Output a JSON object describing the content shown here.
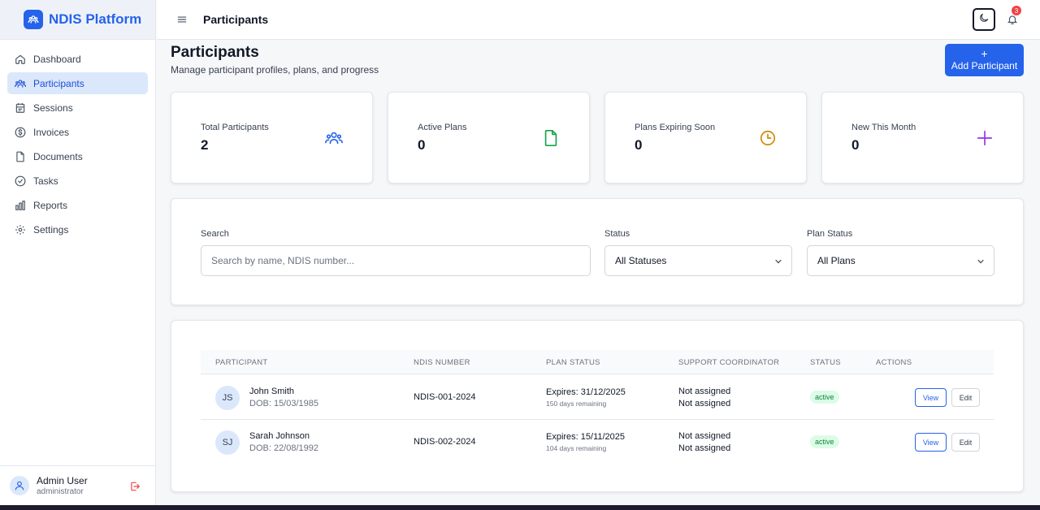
{
  "brand": {
    "name": "NDIS Platform",
    "accent": "#2563eb"
  },
  "sidebar": {
    "items": [
      {
        "label": "Dashboard",
        "icon": "home-icon",
        "active": false
      },
      {
        "label": "Participants",
        "icon": "users-icon",
        "active": true
      },
      {
        "label": "Sessions",
        "icon": "calendar-icon",
        "active": false
      },
      {
        "label": "Invoices",
        "icon": "dollar-icon",
        "active": false
      },
      {
        "label": "Documents",
        "icon": "file-icon",
        "active": false
      },
      {
        "label": "Tasks",
        "icon": "check-circle-icon",
        "active": false
      },
      {
        "label": "Reports",
        "icon": "bar-chart-icon",
        "active": false
      },
      {
        "label": "Settings",
        "icon": "gear-icon",
        "active": false
      }
    ],
    "user": {
      "name": "Admin User",
      "role": "administrator"
    }
  },
  "header": {
    "title": "Participants",
    "notification_count": "3"
  },
  "page": {
    "title": "Participants",
    "subtitle": "Manage participant profiles, plans, and progress",
    "add_button": {
      "icon": "+",
      "label": "Add Participant"
    }
  },
  "stats": [
    {
      "label": "Total Participants",
      "value": "2",
      "icon": "users-icon",
      "color": "#2563eb"
    },
    {
      "label": "Active Plans",
      "value": "0",
      "icon": "file-icon",
      "color": "#16a34a"
    },
    {
      "label": "Plans Expiring Soon",
      "value": "0",
      "icon": "clock-icon",
      "color": "#ca8a04"
    },
    {
      "label": "New This Month",
      "value": "0",
      "icon": "plus-icon",
      "color": "#9333ea"
    }
  ],
  "filters": {
    "search": {
      "label": "Search",
      "placeholder": "Search by name, NDIS number..."
    },
    "status": {
      "label": "Status",
      "value": "All Statuses"
    },
    "plan_status": {
      "label": "Plan Status",
      "value": "All Plans"
    }
  },
  "table": {
    "columns": [
      "PARTICIPANT",
      "NDIS NUMBER",
      "PLAN STATUS",
      "SUPPORT COORDINATOR",
      "STATUS",
      "ACTIONS"
    ],
    "rows": [
      {
        "initials": "JS",
        "name": "John Smith",
        "dob": "DOB: 15/03/1985",
        "ndis": "NDIS-001-2024",
        "expires": "Expires: 31/12/2025",
        "remaining": "150 days remaining",
        "coordinator_line1": "Not assigned",
        "coordinator_line2": "Not assigned",
        "status": "active",
        "view": "View",
        "edit": "Edit"
      },
      {
        "initials": "SJ",
        "name": "Sarah Johnson",
        "dob": "DOB: 22/08/1992",
        "ndis": "NDIS-002-2024",
        "expires": "Expires: 15/11/2025",
        "remaining": "104 days remaining",
        "coordinator_line1": "Not assigned",
        "coordinator_line2": "Not assigned",
        "status": "active",
        "view": "View",
        "edit": "Edit"
      }
    ]
  }
}
